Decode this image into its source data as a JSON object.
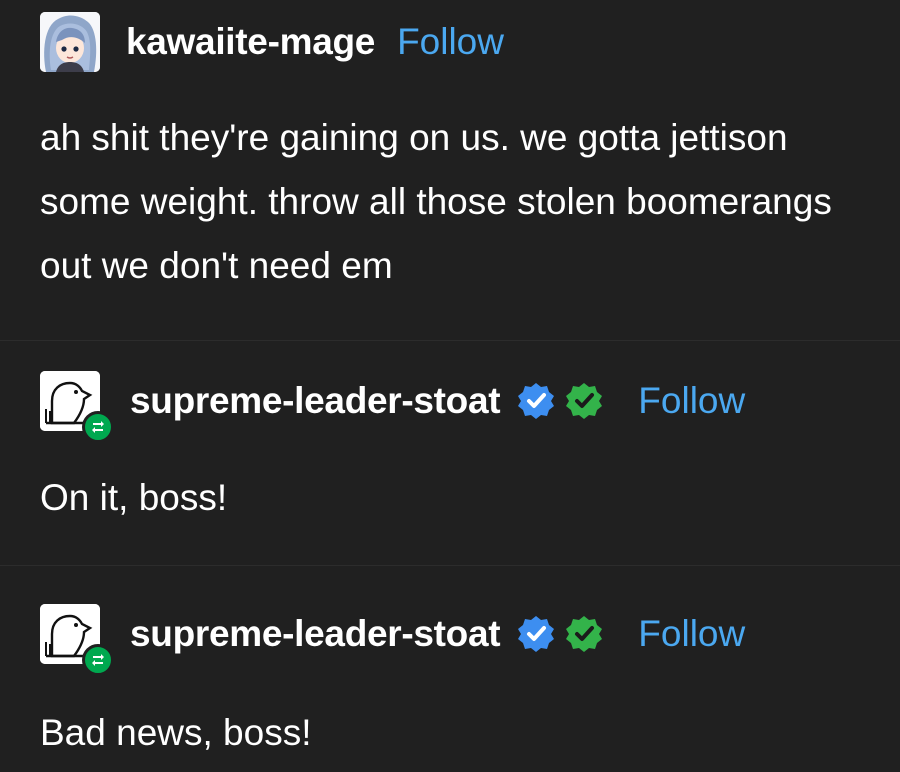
{
  "posts": [
    {
      "username": "kawaiite-mage",
      "follow_label": "Follow",
      "avatar_icon": "anime-girl-avatar",
      "body": "ah shit they're gaining on us. we gotta jettison some weight. throw all those stolen boomerangs out we don't need em"
    },
    {
      "username": "supreme-leader-stoat",
      "follow_label": "Follow",
      "avatar_icon": "stoat-drawing-avatar",
      "reblog_icon": "reblog-icon",
      "badges": [
        "blue-verified-icon",
        "green-verified-icon"
      ],
      "body": "On it, boss!"
    },
    {
      "username": "supreme-leader-stoat",
      "follow_label": "Follow",
      "avatar_icon": "stoat-drawing-avatar",
      "reblog_icon": "reblog-icon",
      "badges": [
        "blue-verified-icon",
        "green-verified-icon"
      ],
      "body": "Bad news, boss!"
    }
  ],
  "colors": {
    "background": "#202020",
    "text": "#ffffff",
    "follow_link": "#4ba8f0",
    "verified_blue": "#3d8ef0",
    "verified_green": "#33b34a",
    "reblog_green": "#00a84f"
  }
}
